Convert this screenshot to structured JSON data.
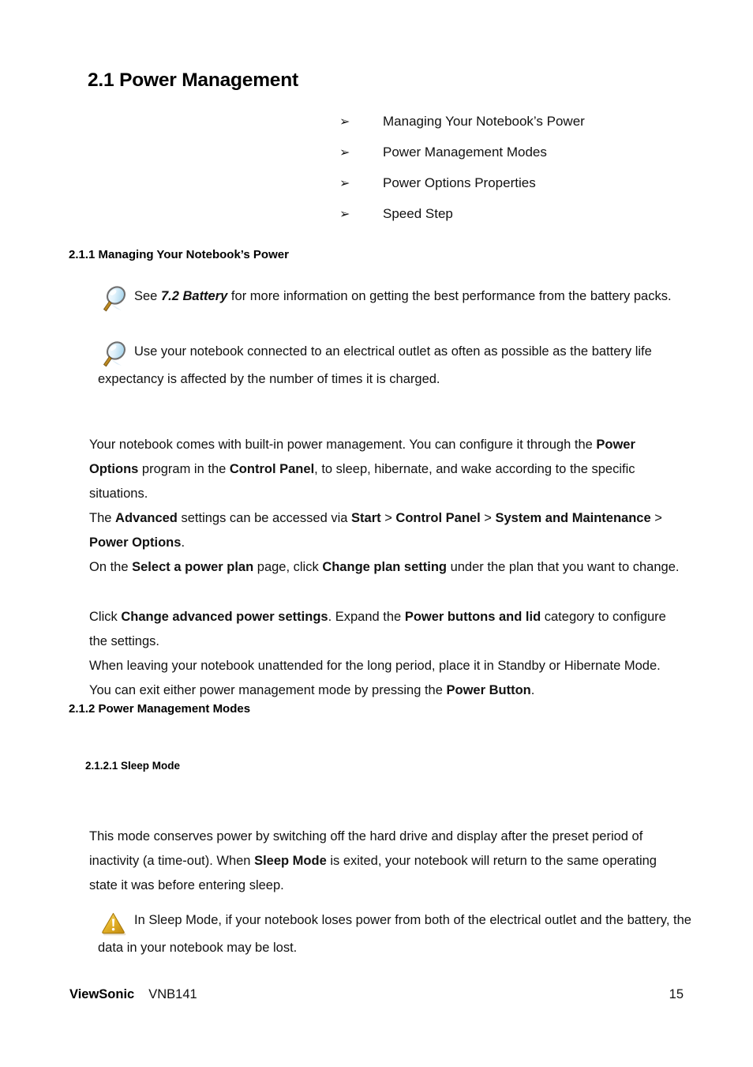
{
  "document": {
    "heading": "2.1 Power Management",
    "toc_bullets": [
      {
        "marker": "➢",
        "label": "Managing Your Notebook’s Power"
      },
      {
        "marker": "➢",
        "label": "Power Management Modes"
      },
      {
        "marker": "➢",
        "label": "Power Options Properties"
      },
      {
        "marker": "➢",
        "label": "Speed Step"
      }
    ],
    "section_211_heading": "2.1.1 Managing Your Notebook’s Power",
    "section_212_heading": "2.1.2 Power Management Modes",
    "section_2121_heading": "2.1.2.1 Sleep Mode",
    "notes": [
      {
        "icon": "magnifier-icon",
        "segments": [
          {
            "text": "See ",
            "style": "normal"
          },
          {
            "text": "7.2 Battery",
            "style": "bold-italic"
          },
          {
            "text": " for more information on getting the best performance from the battery packs.",
            "style": "normal"
          }
        ]
      },
      {
        "icon": "magnifier-icon",
        "segments": [
          {
            "text": "Use your notebook connected to an electrical outlet as often as possible as the battery life expectancy is affected by the number of times it is charged.",
            "style": "normal"
          }
        ]
      },
      {
        "icon": "warning-triangle-icon",
        "segments": [
          {
            "text": "In Sleep Mode, if your notebook loses power from both of the electrical outlet and the battery, the data in your notebook may be lost.",
            "style": "normal"
          }
        ]
      }
    ],
    "paragraphs": [
      {
        "id": "p1",
        "segments": [
          {
            "text": "Your notebook comes with built-in power management. You can configure it through the ",
            "style": "normal"
          },
          {
            "text": "Power Options",
            "style": "bold"
          },
          {
            "text": " program in the ",
            "style": "normal"
          },
          {
            "text": "Control Panel",
            "style": "bold"
          },
          {
            "text": ", to sleep, hibernate, and wake according to the specific situations.",
            "style": "normal"
          }
        ]
      },
      {
        "id": "p2",
        "segments": [
          {
            "text": "The ",
            "style": "normal"
          },
          {
            "text": "Advanced",
            "style": "bold"
          },
          {
            "text": " settings can be accessed via ",
            "style": "normal"
          },
          {
            "text": "Start",
            "style": "bold"
          },
          {
            "text": " > ",
            "style": "normal"
          },
          {
            "text": "Control Panel",
            "style": "bold"
          },
          {
            "text": " > ",
            "style": "normal"
          },
          {
            "text": "System and Maintenance",
            "style": "bold"
          },
          {
            "text": " > ",
            "style": "normal"
          },
          {
            "text": "Power Options",
            "style": "bold"
          },
          {
            "text": ".",
            "style": "normal"
          }
        ]
      },
      {
        "id": "p3",
        "segments": [
          {
            "text": "On the ",
            "style": "normal"
          },
          {
            "text": "Select a power plan",
            "style": "bold"
          },
          {
            "text": " page, click ",
            "style": "normal"
          },
          {
            "text": "Change plan setting",
            "style": "bold"
          },
          {
            "text": " under the plan that you want to change.",
            "style": "normal"
          }
        ]
      },
      {
        "id": "p4",
        "segments": [
          {
            "text": "Click ",
            "style": "normal"
          },
          {
            "text": "Change advanced power settings",
            "style": "bold"
          },
          {
            "text": ". Expand the ",
            "style": "normal"
          },
          {
            "text": "Power buttons and lid",
            "style": "bold"
          },
          {
            "text": " category to configure the settings.",
            "style": "normal"
          }
        ]
      },
      {
        "id": "p5",
        "segments": [
          {
            "text": "When leaving your notebook unattended for the long period, place it in Standby or Hibernate Mode. You can exit either power management mode by pressing the ",
            "style": "normal"
          },
          {
            "text": "Power Button",
            "style": "bold"
          },
          {
            "text": ".",
            "style": "normal"
          }
        ]
      },
      {
        "id": "p6",
        "segments": [
          {
            "text": "This mode conserves power by switching off the hard drive and display after the preset period of inactivity (a time-out). When ",
            "style": "normal"
          },
          {
            "text": "Sleep Mode",
            "style": "bold"
          },
          {
            "text": " is exited, your notebook will return to the same operating state it was before entering sleep.",
            "style": "normal"
          }
        ]
      }
    ],
    "footer": {
      "brand": "ViewSonic",
      "model": "VNB141",
      "page_number": "15"
    },
    "colors": {
      "text": "#111111",
      "page_background": "#ffffff",
      "magnifier_lens": "#bfe4f5",
      "magnifier_rim": "#6b6b6b",
      "magnifier_handle": "#c08a1e",
      "warning_fill": "#e8b425",
      "warning_mark": "#ffffff"
    }
  }
}
